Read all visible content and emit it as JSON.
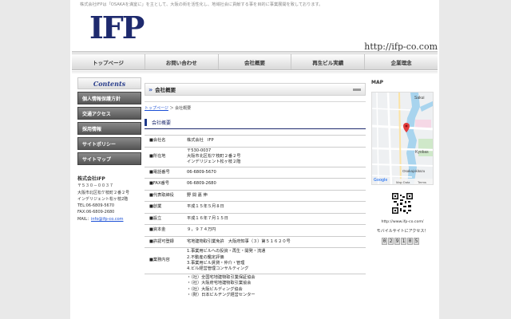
{
  "header": {
    "tagline": "株式会社IFPは「OSAKAを満室に」を主として、大阪の街を活性化し、地域社会に貢献する事を目的に事業展開を致しております。",
    "logo": "IFP",
    "url": "http://ifp-co.com"
  },
  "nav": [
    {
      "label": "トップページ"
    },
    {
      "label": "お問い合わせ"
    },
    {
      "label": "会社概要"
    },
    {
      "label": "再生ビル実績"
    },
    {
      "label": "企業理念"
    }
  ],
  "sidebar": {
    "heading": "Contents",
    "items": [
      {
        "label": "個人情報保護方針"
      },
      {
        "label": "交通アクセス"
      },
      {
        "label": "採用情報"
      },
      {
        "label": "サイトポリシー"
      },
      {
        "label": "サイトマップ"
      }
    ],
    "company": {
      "name": "株式会社IFP",
      "postal": "〒５３０－００３７",
      "address1": "大阪市北区松ケ枝町２番２号",
      "address2": "インデリジェント松ヶ枝2階",
      "tel": "TEL:06-6809-5670",
      "fax": "FAX:06-6809-2680",
      "mail_label": "MAIL：",
      "mail": "info@ifp-co.com"
    }
  },
  "main": {
    "title": "会社概要",
    "breadcrumb_home": "トップページ",
    "breadcrumb_sep": "＞",
    "breadcrumb_current": "会社概要",
    "section_title": "会社概要",
    "rows": [
      {
        "k": "■会社名",
        "v": [
          "株式会社　IFP"
        ]
      },
      {
        "k": "■所在地",
        "v": [
          "〒530-0037",
          "大阪市北区松ケ枝町２番２号",
          "インデリジェント松ヶ枝２階"
        ]
      },
      {
        "k": "■電話番号",
        "v": [
          "06-6809-5670"
        ]
      },
      {
        "k": "■FAX番号",
        "v": [
          "06-6809-2680"
        ]
      },
      {
        "k": "■代表取締役",
        "v": [
          "野 間 嘉 伸"
        ]
      },
      {
        "k": "■創業",
        "v": [
          "平成１５年５月８日"
        ]
      },
      {
        "k": "■設立",
        "v": [
          "平成１６年７月１５日"
        ]
      },
      {
        "k": "■資本金",
        "v": [
          "９，９７４万円"
        ]
      },
      {
        "k": "■許認可登録",
        "v": [
          "宅地建物取引業免許　大阪府知事（３）第５１６２０号"
        ]
      },
      {
        "k": "■業務内容",
        "v": [
          "1.事業用ビルへの投資・再生・開発・流通",
          "2.不動産の鑑定評価",
          "3.事業用ビル賃貸・仲介・管理",
          "4.ビル経営管理コンサルティング"
        ]
      },
      {
        "k": "",
        "v": [
          "・（社）全国宅地建物取引業保証協会",
          "・（社）大阪府宅地建物取引業協会",
          "・（社）大阪ビルディング協会",
          "・（財）日本ビルヂング経営センター"
        ]
      }
    ]
  },
  "right": {
    "map_title": "MAP",
    "map_labels": {
      "place1": "Sakui",
      "place2": "Kyobas",
      "place3": "Osakajokitazu",
      "footer_data": "Map Data",
      "footer_terms": "Terms",
      "google": "Google"
    },
    "qr_url": "http://www.ifp-co.com/",
    "qr_note": "モバイルサイトにアクセス！",
    "counter": [
      "0",
      "2",
      "9",
      "1",
      "0",
      "5"
    ]
  },
  "colors": {
    "navy": "#1e2a6e",
    "link": "#1a4fd6",
    "pin": "#e23b3b"
  }
}
